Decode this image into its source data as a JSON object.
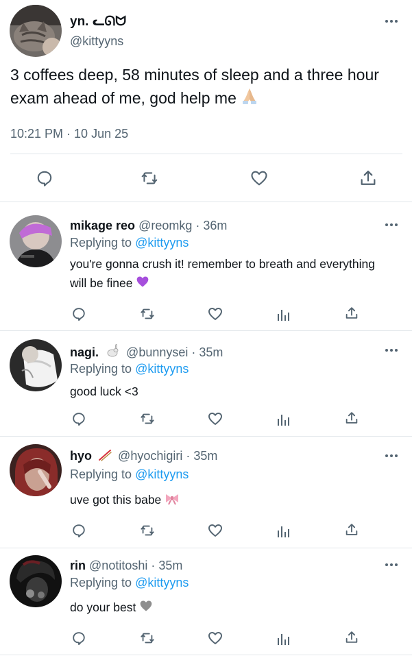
{
  "main_tweet": {
    "display_name": "yn. ᓚᘏᗢ",
    "handle": "@kittyyns",
    "text": "3 coffees deep, 58 minutes of sleep and a three hour exam ahead of me, god help me",
    "timestamp": "10:21 PM · 10 Jun 25"
  },
  "replies": [
    {
      "display_name": "mikage reo",
      "handle": "@reomkg",
      "time": "· 36m",
      "replying_label": "Replying to",
      "replying_handle": "@kittyyns",
      "text": "you're gonna crush it! remember to breath and everything will be finee"
    },
    {
      "display_name": "nagi.",
      "handle": "@bunnysei",
      "time": "· 35m",
      "replying_label": "Replying to",
      "replying_handle": "@kittyyns",
      "text": "good luck <3"
    },
    {
      "display_name": "hyo",
      "handle": "@hyochigiri",
      "time": "· 35m",
      "replying_label": "Replying to",
      "replying_handle": "@kittyyns",
      "text": "uve got this babe"
    },
    {
      "display_name": "rin",
      "handle": "@notitoshi",
      "time": "· 35m",
      "replying_label": "Replying to",
      "replying_handle": "@kittyyns",
      "text": "do your best"
    }
  ],
  "colors": {
    "text": "#0f1419",
    "muted": "#536471",
    "link": "#1d9bf0",
    "divider": "#e1e6ea"
  }
}
